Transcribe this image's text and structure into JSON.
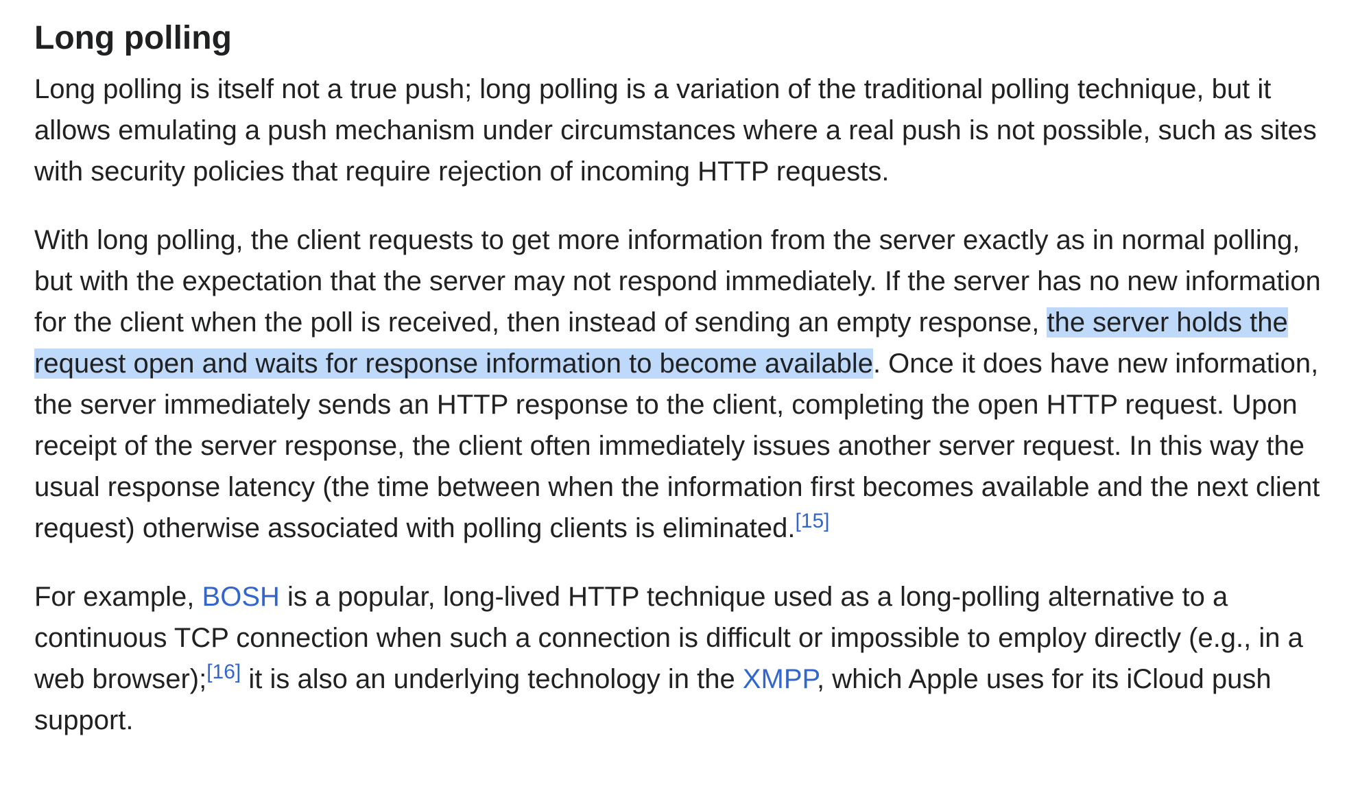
{
  "section": {
    "heading": "Long polling"
  },
  "paragraphs": {
    "p1": "Long polling is itself not a true push; long polling is a variation of the traditional polling technique, but it allows emulating a push mechanism under circumstances where a real push is not possible, such as sites with security policies that require rejection of incoming HTTP requests.",
    "p2_before": "With long polling, the client requests to get more information from the server exactly as in normal polling, but with the expectation that the server may not respond immediately. If the server has no new information for the client when the poll is received, then instead of sending an empty response, ",
    "p2_highlight": "the server holds the request open and waits for response information to become available",
    "p2_after": ". Once it does have new information, the server immediately sends an HTTP response to the client, completing the open HTTP request. Upon receipt of the server response, the client often immediately issues another server request. In this way the usual response latency (the time between when the information first becomes available and the next client request) otherwise associated with polling clients is eliminated.",
    "p2_cite": "[15]",
    "p3_a": "For example, ",
    "p3_link_bosh": "BOSH",
    "p3_b": " is a popular, long-lived HTTP technique used as a long-polling alternative to a continuous TCP connection when such a connection is difficult or impossible to employ directly (e.g., in a web browser);",
    "p3_cite": "[16]",
    "p3_c": " it is also an underlying technology in the ",
    "p3_link_xmpp": "XMPP",
    "p3_d": ", which Apple uses for its iCloud push support."
  },
  "colors": {
    "text": "#202122",
    "link": "#3366cc",
    "selection": "#bfd9fb"
  }
}
